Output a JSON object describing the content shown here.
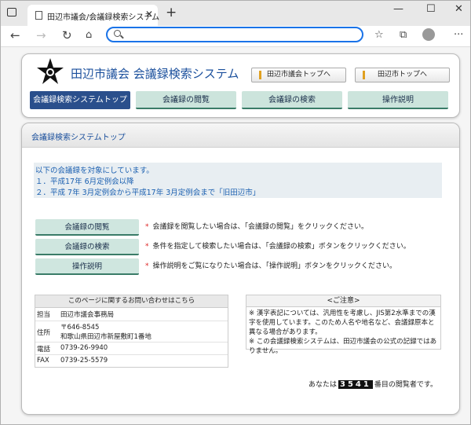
{
  "browser": {
    "tab_title": "田辺市議会/会議録検索システム",
    "tab_close": "✕",
    "new_tab": "+",
    "address_value": ""
  },
  "header": {
    "site_title": "田辺市議会 会議録検索システム",
    "link_council_top": "田辺市議会トップへ",
    "link_city_top": "田辺市トップへ"
  },
  "menu": {
    "tabs": [
      {
        "label": "会議録検索システムトップ"
      },
      {
        "label": "会議録の閲覧"
      },
      {
        "label": "会議録の検索"
      },
      {
        "label": "操作説明"
      }
    ]
  },
  "content": {
    "title": "会議録検索システムトップ",
    "intro": {
      "line1": "以下の会議録を対象にしています。",
      "line2": "１．平成17年 6月定例会以降",
      "line3": "２．平成 7年 3月定例会から平成17年 3月定例会まで「旧田辺市」"
    },
    "actions": [
      {
        "button": "会議録の閲覧",
        "desc": "会議録を閲覧したい場合は、「会議録の閲覧」をクリックください。"
      },
      {
        "button": "会議録の検索",
        "desc": "条件を指定して検索したい場合は、「会議録の検索」ボタンをクリックください。"
      },
      {
        "button": "操作説明",
        "desc": "操作説明をご覧になりたい場合は、「操作説明」ボタンをクリックください。"
      }
    ],
    "contact": {
      "heading": "このページに関するお問い合わせはこちら",
      "rows": [
        {
          "key": "担当",
          "value": "田辺市議会事務局"
        },
        {
          "key": "住所",
          "value": "〒646-8545",
          "value2": "和歌山県田辺市新屋敷町1番地"
        },
        {
          "key": "電話",
          "value": "0739-26-9940"
        },
        {
          "key": "FAX",
          "value": "0739-25-5579"
        }
      ]
    },
    "notice": {
      "heading": "<ご注意>",
      "text1": "※ 漢字表記については、汎用性を考慮し、JIS第2水準までの漢字を使用しています。このため人名や地名など、会議録原本と異なる場合があります。",
      "text2": "※ この会議録検索システムは、田辺市議会の公式の記録ではありません。"
    },
    "counter": {
      "prefix": "あなたは",
      "number": "3541",
      "suffix": "番目の閲覧者です。"
    }
  },
  "colors": {
    "title_blue": "#1a4f9c",
    "menu_active": "#2a4f8c",
    "menu_normal": "#cce4dc",
    "accent_red": "#dd2222",
    "address_focus": "#1a73e8"
  }
}
